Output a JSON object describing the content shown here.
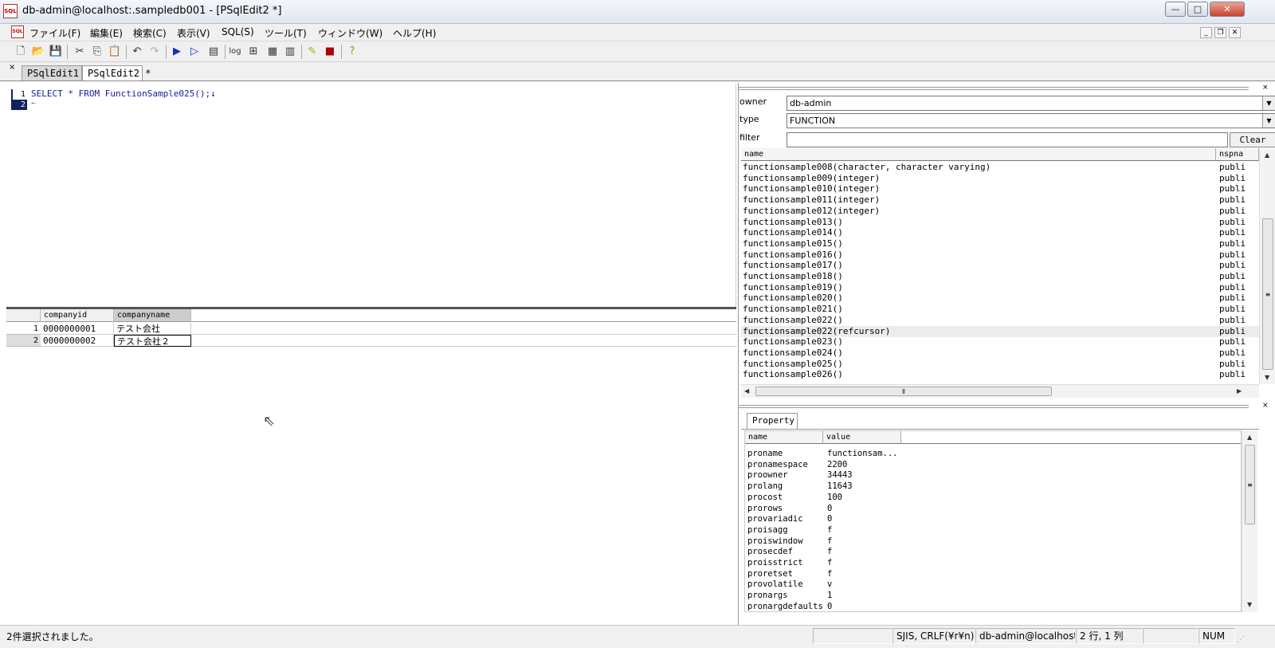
{
  "window": {
    "title": "db-admin@localhost:.sampledb001 - [PSqlEdit2 *]",
    "icon_text": "SQL",
    "minimize": "—",
    "maximize": "□",
    "close": "✕"
  },
  "menu": {
    "items": [
      "ファイル(F)",
      "編集(E)",
      "検索(C)",
      "表示(V)",
      "SQL(S)",
      "ツール(T)",
      "ウィンドウ(W)",
      "ヘルプ(H)"
    ],
    "mdi_minimize": "_",
    "mdi_restore": "❐",
    "mdi_close": "✕"
  },
  "toolbar": {
    "log_label": "log"
  },
  "tabs": {
    "close_glyph": "×",
    "items": [
      "PSqlEdit1 *",
      "PSqlEdit2 *"
    ]
  },
  "editor": {
    "line_numbers": [
      "1",
      "2"
    ],
    "sql": "SELECT * FROM FunctionSample025();↓",
    "eof": "←"
  },
  "result_grid": {
    "columns": [
      "companyid",
      "companyname"
    ],
    "rows": [
      {
        "num": "1",
        "companyid": "0000000001",
        "companyname": "テスト会社"
      },
      {
        "num": "2",
        "companyid": "0000000002",
        "companyname": "テスト会社２"
      }
    ]
  },
  "object_browser": {
    "owner_label": "owner",
    "owner_value": "db-admin",
    "type_label": "type",
    "type_value": "FUNCTION",
    "filter_label": "filter",
    "filter_value": "",
    "clear_button": "Clear",
    "columns": [
      "name",
      "nspna"
    ],
    "functions": [
      {
        "name": "functionsample008(character, character varying)",
        "ns": "publi"
      },
      {
        "name": "functionsample009(integer)",
        "ns": "publi"
      },
      {
        "name": "functionsample010(integer)",
        "ns": "publi"
      },
      {
        "name": "functionsample011(integer)",
        "ns": "publi"
      },
      {
        "name": "functionsample012(integer)",
        "ns": "publi"
      },
      {
        "name": "functionsample013()",
        "ns": "publi"
      },
      {
        "name": "functionsample014()",
        "ns": "publi"
      },
      {
        "name": "functionsample015()",
        "ns": "publi"
      },
      {
        "name": "functionsample016()",
        "ns": "publi"
      },
      {
        "name": "functionsample017()",
        "ns": "publi"
      },
      {
        "name": "functionsample018()",
        "ns": "publi"
      },
      {
        "name": "functionsample019()",
        "ns": "publi"
      },
      {
        "name": "functionsample020()",
        "ns": "publi"
      },
      {
        "name": "functionsample021()",
        "ns": "publi"
      },
      {
        "name": "functionsample022()",
        "ns": "publi"
      },
      {
        "name": "functionsample022(refcursor)",
        "ns": "publi"
      },
      {
        "name": "functionsample023()",
        "ns": "publi"
      },
      {
        "name": "functionsample024()",
        "ns": "publi"
      },
      {
        "name": "functionsample025()",
        "ns": "publi"
      },
      {
        "name": "functionsample026()",
        "ns": "publi"
      }
    ],
    "selected_index": 15
  },
  "property_panel": {
    "tab_label": "Property",
    "columns": [
      "name",
      "value"
    ],
    "rows": [
      {
        "name": "proname",
        "value": "functionsam..."
      },
      {
        "name": "pronamespace",
        "value": "2200"
      },
      {
        "name": "proowner",
        "value": "34443"
      },
      {
        "name": "prolang",
        "value": "11643"
      },
      {
        "name": "procost",
        "value": "100"
      },
      {
        "name": "prorows",
        "value": "0"
      },
      {
        "name": "provariadic",
        "value": "0"
      },
      {
        "name": "proisagg",
        "value": "f"
      },
      {
        "name": "proiswindow",
        "value": "f"
      },
      {
        "name": "prosecdef",
        "value": "f"
      },
      {
        "name": "proisstrict",
        "value": "f"
      },
      {
        "name": "proretset",
        "value": "f"
      },
      {
        "name": "provolatile",
        "value": "v"
      },
      {
        "name": "pronargs",
        "value": "1"
      },
      {
        "name": "pronargdefaults",
        "value": "0"
      }
    ]
  },
  "status": {
    "message": "2件選択されました。",
    "encoding": "SJIS, CRLF(¥r¥n)",
    "connection": "db-admin@localhost:",
    "position": "2 行, 1 列",
    "num": "NUM"
  }
}
